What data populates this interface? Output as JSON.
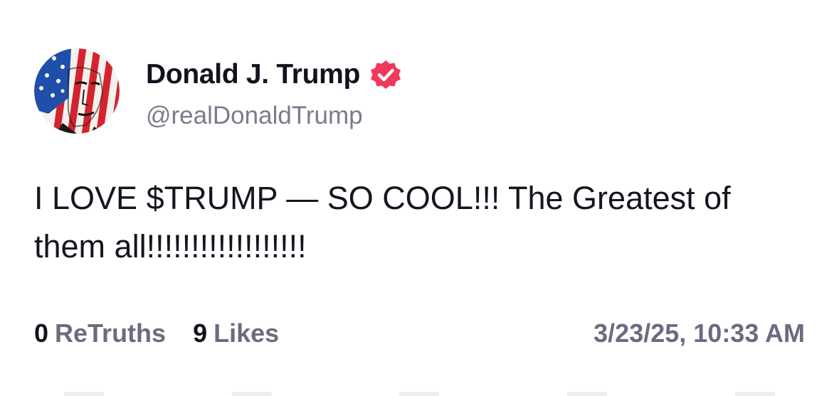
{
  "author": {
    "display_name": "Donald J. Trump",
    "handle": "@realDonaldTrump",
    "verified_icon": "verified-badge-icon",
    "badge_color": "#f0385a",
    "avatar": "avatar-american-flag-portrait"
  },
  "post": {
    "text": "I LOVE $TRUMP — SO COOL!!! The Greatest of them all!!!!!!!!!!!!!!!!!!"
  },
  "stats": {
    "retruths_count": "0",
    "retruths_label": "ReTruths",
    "likes_count": "9",
    "likes_label": "Likes"
  },
  "timestamp": "3/23/25, 10:33 AM"
}
